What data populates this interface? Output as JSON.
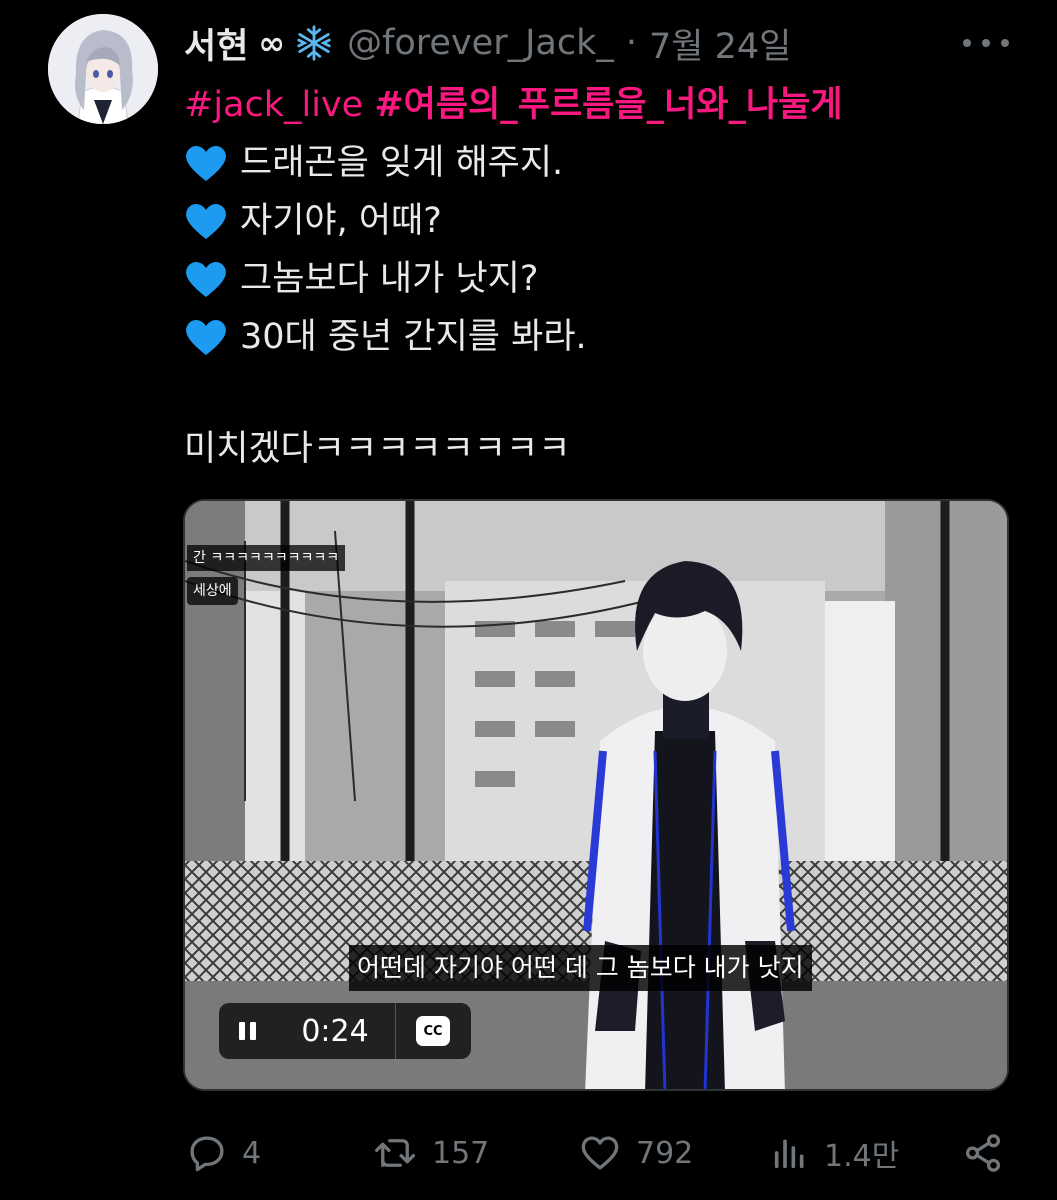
{
  "tweet": {
    "display_name": "서현",
    "infinity_symbol": "∞",
    "handle": "@forever_Jack_",
    "dot": "·",
    "date": "7월 24일",
    "hashtag1": "#jack_live",
    "hashtag2": "#여름의_푸르름을_너와_나눌게",
    "lines": [
      "드래곤을 잊게 해주지.",
      "자기야, 어때?",
      "그놈보다 내가 낫지?",
      "30대 중년 간지를 봐라."
    ],
    "closing": "미치겠다ㅋㅋㅋㅋㅋㅋㅋㅋ"
  },
  "video": {
    "chat_line1": "간 ㅋㅋㅋㅋㅋㅋㅋㅋㅋㅋ",
    "chat_line2": "세상에",
    "subtitle": "어떤데 자기야 어떤 데 그 놈보다 내가 낫지",
    "time": "0:24",
    "cc_label": "CC"
  },
  "actions": {
    "replies": "4",
    "retweets": "157",
    "likes": "792",
    "views": "1.4만"
  },
  "colors": {
    "hashtag": "#f91880",
    "secondary_text": "#71767b",
    "heart": "#1d9bf0"
  },
  "icons": [
    "snowflake-icon",
    "blue-heart-icon",
    "more-icon",
    "pause-icon",
    "cc-icon",
    "reply-icon",
    "retweet-icon",
    "like-icon",
    "views-icon",
    "share-icon"
  ]
}
